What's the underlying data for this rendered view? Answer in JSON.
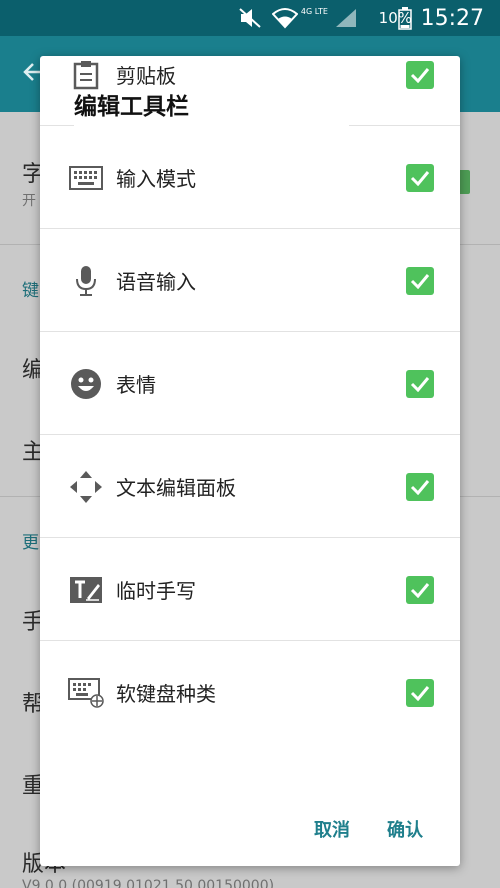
{
  "status_bar": {
    "time": "15:27",
    "battery_percent": "10%",
    "network_type": "4G LTE",
    "icons": [
      "mute-icon",
      "wifi-icon",
      "signal-icon",
      "battery-icon"
    ]
  },
  "background": {
    "rows": [
      {
        "char": "字",
        "sub": "开"
      },
      {
        "section": "键"
      },
      {
        "char": "编"
      },
      {
        "char": "主"
      },
      {
        "section": "更"
      },
      {
        "char": "手"
      },
      {
        "char": "帮"
      },
      {
        "char": "重"
      },
      {
        "char": "版本",
        "sub": "V9.0.0 (00919.01021.50.00150000)"
      }
    ]
  },
  "dialog": {
    "title": "编辑工具栏",
    "options": [
      {
        "label": "剪贴板",
        "icon": "clipboard-icon",
        "checked": true
      },
      {
        "label": "输入模式",
        "icon": "keyboard-icon",
        "checked": true
      },
      {
        "label": "语音输入",
        "icon": "microphone-icon",
        "checked": true
      },
      {
        "label": "表情",
        "icon": "emoji-icon",
        "checked": true
      },
      {
        "label": "文本编辑面板",
        "icon": "text-edit-arrows-icon",
        "checked": true
      },
      {
        "label": "临时手写",
        "icon": "handwriting-icon",
        "checked": true
      },
      {
        "label": "软键盘种类",
        "icon": "keyboard-type-icon",
        "checked": true
      }
    ],
    "cancel_label": "取消",
    "ok_label": "确认"
  },
  "colors": {
    "status_bar": "#0b5f6c",
    "app_bar": "#1a7f8d",
    "accent": "#1f7f8c",
    "check_green": "#4fc25c"
  }
}
